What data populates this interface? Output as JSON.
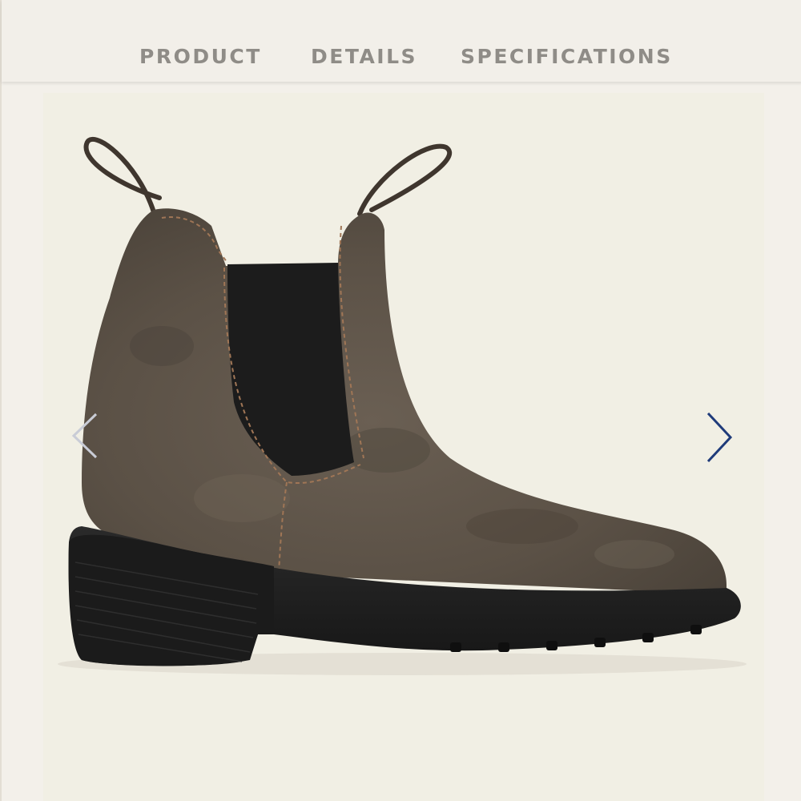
{
  "tabs": [
    {
      "label": "PRODUCT"
    },
    {
      "label": "DETAILS"
    },
    {
      "label": "SPECIFICATIONS"
    }
  ],
  "gallery": {
    "prev_icon": "chevron-left-icon",
    "next_icon": "chevron-right-icon",
    "image": "chelsea-boot-product-photo"
  },
  "colors": {
    "background": "#f3f0ea",
    "tab_text": "#8f8c87",
    "leather": "#5e5449",
    "elastic": "#1c1c1c",
    "sole": "#1f1f1f",
    "next_arrow": "#1f3b7a",
    "prev_arrow": "#c9ccd6"
  }
}
